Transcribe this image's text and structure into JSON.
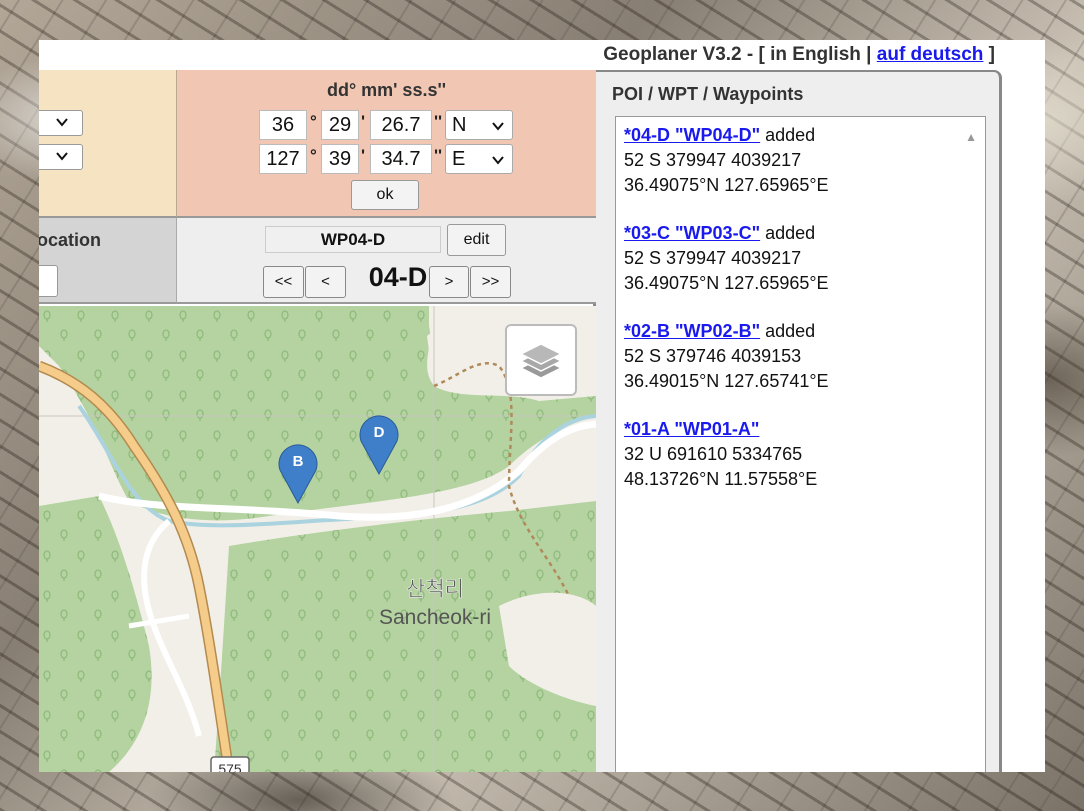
{
  "title": {
    "app": "Geoplaner V3.2 - ",
    "bracket_open": "[ ",
    "lang_en": "in English",
    "separator": " | ",
    "lang_de": "auf deutsch",
    "bracket_close": " ]"
  },
  "dms_panel": {
    "title": "dd° mm' ss.s''",
    "lat": {
      "deg": "36",
      "min": "29",
      "sec": "26.7",
      "hemi": "N"
    },
    "lon": {
      "deg": "127",
      "min": "39",
      "sec": "34.7",
      "hemi": "E"
    },
    "deg_mark": "°",
    "min_mark": "'",
    "sec_mark": "''",
    "ok_label": "ok"
  },
  "location_panel": {
    "label": "ocation"
  },
  "waypoint_panel": {
    "name": "WP04-D",
    "edit_label": "edit",
    "first_label": "<<",
    "prev_label": "<",
    "current_id": "04-D",
    "next_label": ">",
    "last_label": ">>"
  },
  "map": {
    "place_korean": "산척리",
    "place_latin": "Sancheok-ri",
    "road_number": "575",
    "markers": [
      {
        "label": "B"
      },
      {
        "label": "D"
      }
    ],
    "colors": {
      "forest": "#b4d3a0",
      "land": "#f2efe9",
      "road": "#f6cc8a",
      "river": "#aad3df",
      "marker": "#3f7fc9"
    }
  },
  "poi_panel": {
    "title": "POI / WPT / Waypoints",
    "entries": [
      {
        "link": "*04-D \"WP04-D\"",
        "status": " added",
        "utm": "52 S 379947 4039217",
        "latlon": "36.49075°N 127.65965°E"
      },
      {
        "link": "*03-C \"WP03-C\"",
        "status": " added",
        "utm": "52 S 379947 4039217",
        "latlon": "36.49075°N 127.65965°E"
      },
      {
        "link": "*02-B \"WP02-B\"",
        "status": " added",
        "utm": "52 S 379746 4039153",
        "latlon": "36.49015°N 127.65741°E"
      },
      {
        "link": "*01-A \"WP01-A\"",
        "status": "",
        "utm": "32 U 691610 5334765",
        "latlon": "48.13726°N 11.57558°E"
      }
    ]
  }
}
